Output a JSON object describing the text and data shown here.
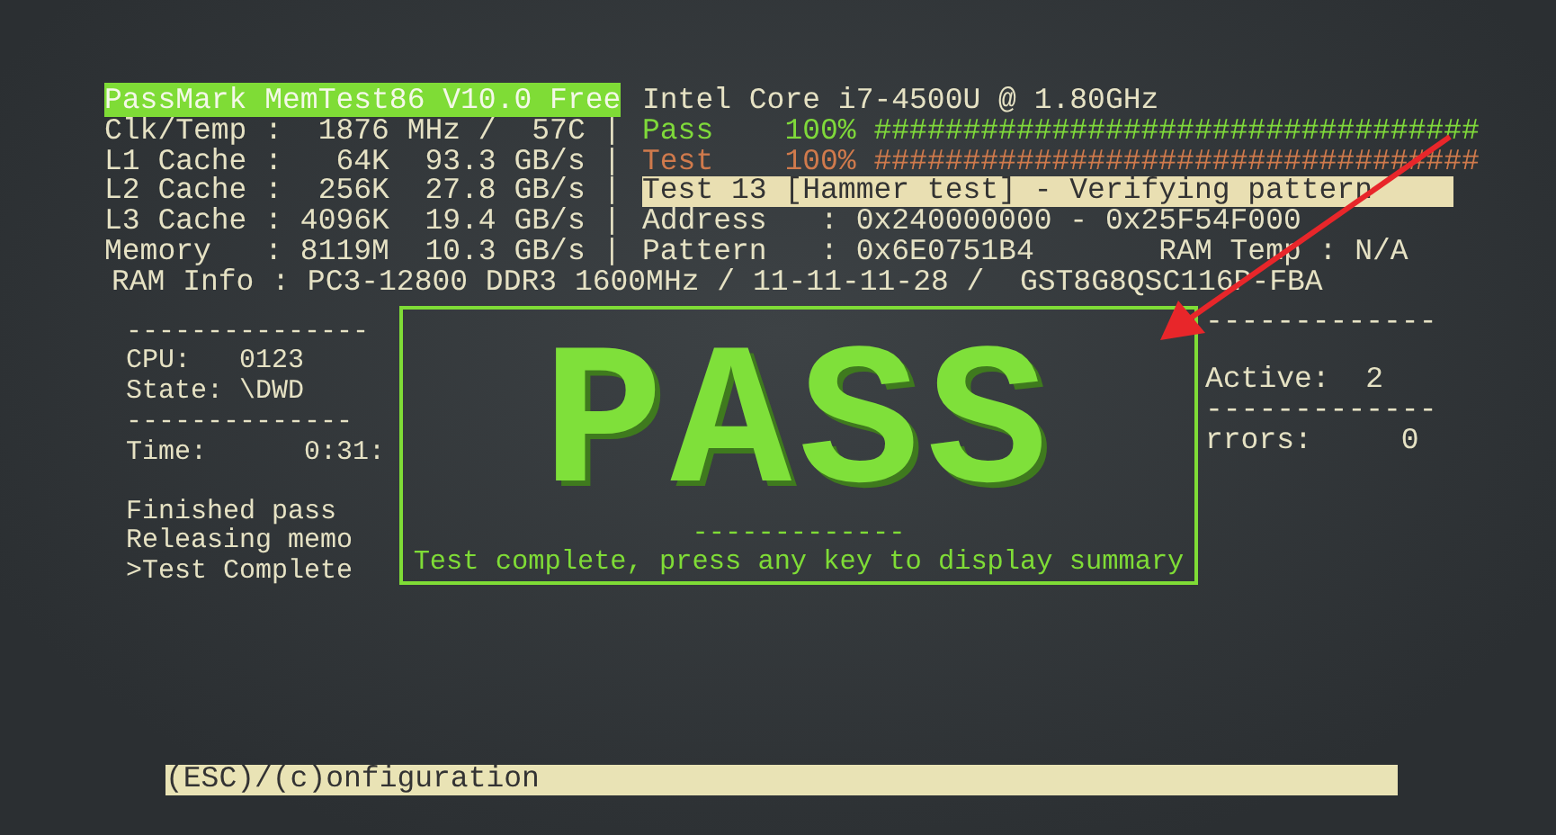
{
  "header": {
    "title": "PassMark MemTest86 V10.0 Free",
    "cpu_model": "Intel Core i7-4500U @ 1.80GHz"
  },
  "system_info": [
    "Clk/Temp :  1876 MHz /  57C |",
    "L1 Cache :   64K  93.3 GB/s |",
    "L2 Cache :  256K  27.8 GB/s |",
    "L3 Cache : 4096K  19.4 GB/s |",
    "Memory   : 8119M  10.3 GB/s |"
  ],
  "progress": [
    {
      "kind": "pass",
      "label": "Pass",
      "percent": "100%",
      "bar": "##################################"
    },
    {
      "kind": "test",
      "label": "Test",
      "percent": "100%",
      "bar": "##################################"
    }
  ],
  "current_test": "Test 13 [Hammer test] - Verifying pattern",
  "address": {
    "label": "Address",
    "value": ": 0x240000000 - 0x25F54F000"
  },
  "pattern": {
    "label": "Pattern",
    "value": ": 0x6E0751B4"
  },
  "ram_temp": {
    "label": "RAM Temp",
    "value": ": N/A"
  },
  "ram_info": "RAM Info : PC3-12800 DDR3 1600MHz / 11-11-11-28 /  GST8G8QSC116P-FBA",
  "left_panel": [
    {
      "lines": [
        "---------------",
        "CPU:   0123",
        "State: \\DWD",
        "--------------",
        "Time:      0:31:"
      ]
    },
    {
      "lines": [
        "Finished pass",
        "Releasing memo",
        ">Test Complete"
      ]
    }
  ],
  "right_panel": [
    {
      "lines": [
        "-------------"
      ]
    },
    {
      "lines": [
        "Active:  2",
        "-------------",
        "rrors:     0"
      ]
    }
  ],
  "popup": {
    "title": "PASS",
    "rule": "-------------",
    "message": "Test complete, press any key to display summary"
  },
  "footer": "(ESC)/(c)onfiguration"
}
